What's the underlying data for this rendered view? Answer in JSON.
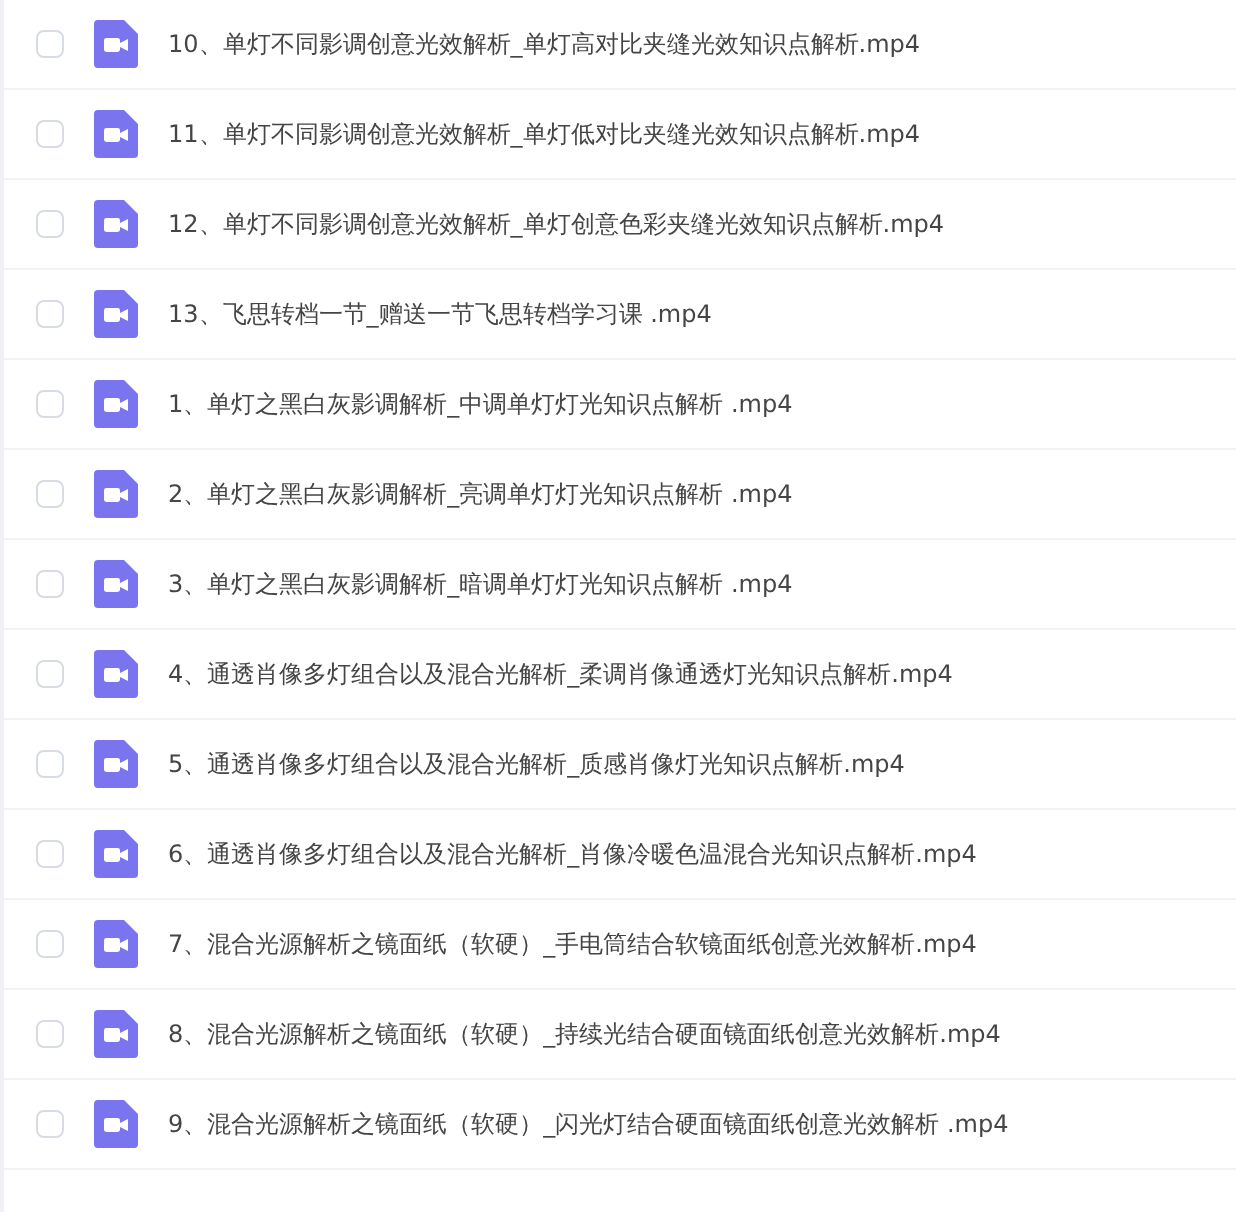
{
  "files": [
    {
      "name": "10、单灯不同影调创意光效解析_单灯高对比夹缝光效知识点解析.mp4",
      "checked": false
    },
    {
      "name": "11、单灯不同影调创意光效解析_单灯低对比夹缝光效知识点解析.mp4",
      "checked": false
    },
    {
      "name": "12、单灯不同影调创意光效解析_单灯创意色彩夹缝光效知识点解析.mp4",
      "checked": false
    },
    {
      "name": "13、飞思转档一节_赠送一节飞思转档学习课 .mp4",
      "checked": false
    },
    {
      "name": "1、单灯之黑白灰影调解析_中调单灯灯光知识点解析 .mp4",
      "checked": false
    },
    {
      "name": "2、单灯之黑白灰影调解析_亮调单灯灯光知识点解析 .mp4",
      "checked": false
    },
    {
      "name": "3、单灯之黑白灰影调解析_暗调单灯灯光知识点解析 .mp4",
      "checked": false
    },
    {
      "name": "4、通透肖像多灯组合以及混合光解析_柔调肖像通透灯光知识点解析.mp4",
      "checked": false
    },
    {
      "name": "5、通透肖像多灯组合以及混合光解析_质感肖像灯光知识点解析.mp4",
      "checked": false
    },
    {
      "name": "6、通透肖像多灯组合以及混合光解析_肖像冷暖色温混合光知识点解析.mp4",
      "checked": false
    },
    {
      "name": "7、混合光源解析之镜面纸（软硬）_手电筒结合软镜面纸创意光效解析.mp4",
      "checked": false
    },
    {
      "name": "8、混合光源解析之镜面纸（软硬）_持续光结合硬面镜面纸创意光效解析.mp4",
      "checked": false
    },
    {
      "name": "9、混合光源解析之镜面纸（软硬）_闪光灯结合硬面镜面纸创意光效解析 .mp4",
      "checked": false
    }
  ]
}
